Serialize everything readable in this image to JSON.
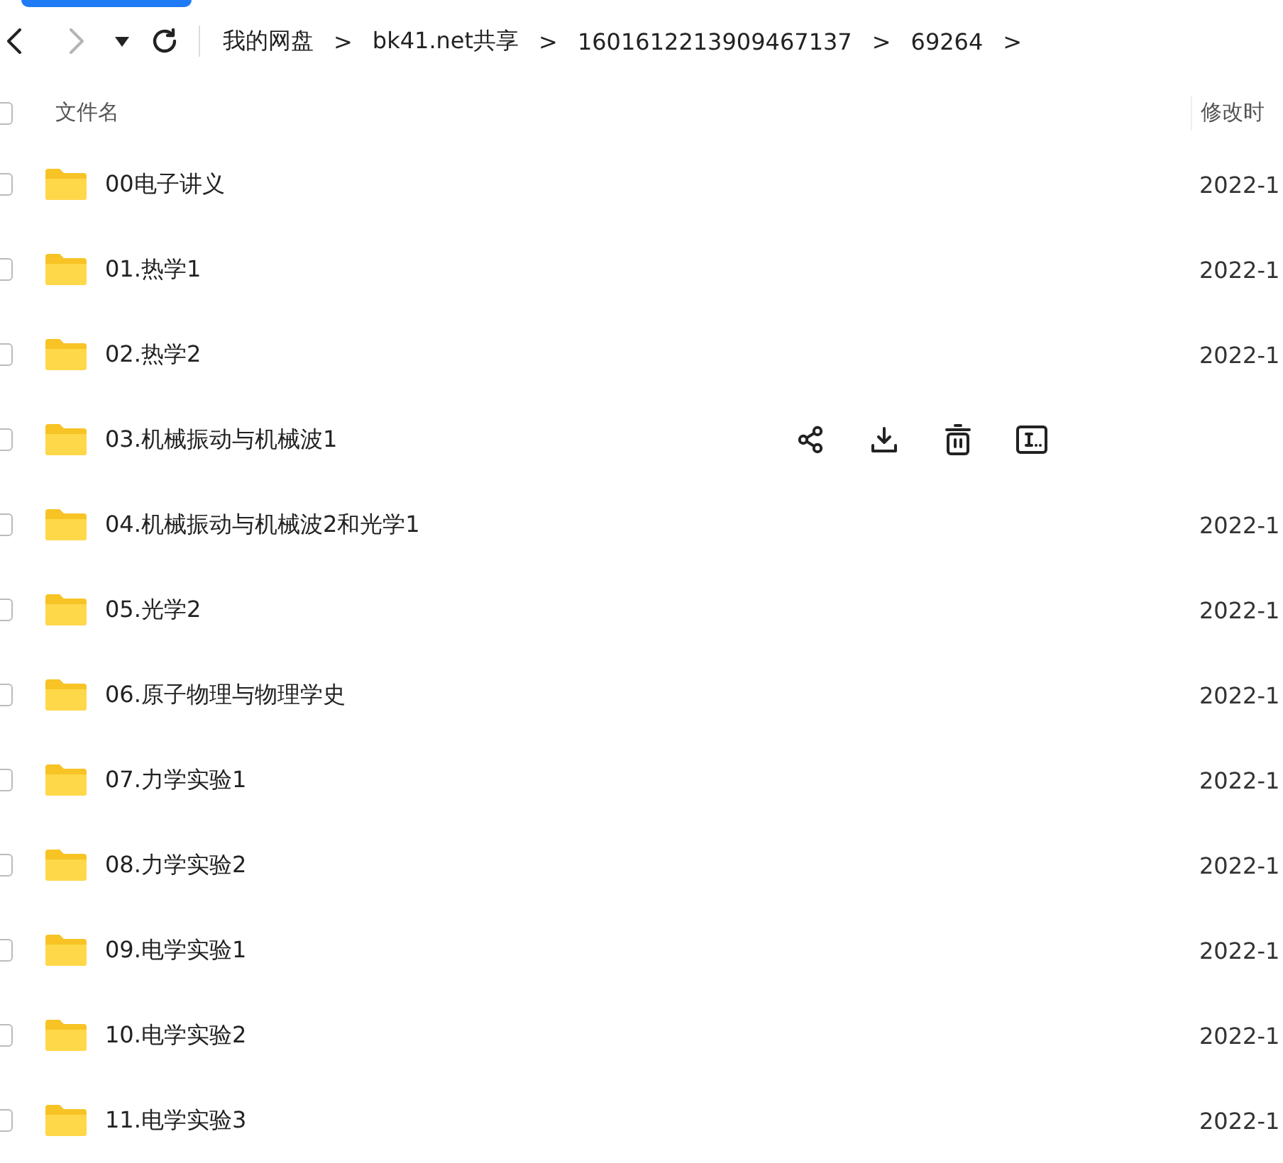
{
  "nav": {
    "back_disabled": false,
    "forward_disabled": true
  },
  "breadcrumb": [
    "我的网盘",
    "bk41.net共享",
    "1601612213909467137",
    "69264"
  ],
  "breadcrumb_separator": ">",
  "columns": {
    "name": "文件名",
    "modified": "修改时",
    "all_checked": false
  },
  "rows": [
    {
      "name": "00电子讲义",
      "modified": "2022-1",
      "hovered": false,
      "checked": false
    },
    {
      "name": "01.热学1",
      "modified": "2022-1",
      "hovered": false,
      "checked": false
    },
    {
      "name": "02.热学2",
      "modified": "2022-1",
      "hovered": false,
      "checked": false
    },
    {
      "name": "03.机械振动与机械波1",
      "hovered": true,
      "checked": false
    },
    {
      "name": "04.机械振动与机械波2和光学1",
      "modified": "2022-1",
      "hovered": false,
      "checked": false
    },
    {
      "name": "05.光学2",
      "modified": "2022-1",
      "hovered": false,
      "checked": false
    },
    {
      "name": "06.原子物理与物理学史",
      "modified": "2022-1",
      "hovered": false,
      "checked": false
    },
    {
      "name": "07.力学实验1",
      "modified": "2022-1",
      "hovered": false,
      "checked": false
    },
    {
      "name": "08.力学实验2",
      "modified": "2022-1",
      "hovered": false,
      "checked": false
    },
    {
      "name": "09.电学实验1",
      "modified": "2022-1",
      "hovered": false,
      "checked": false
    },
    {
      "name": "10.电学实验2",
      "modified": "2022-1",
      "hovered": false,
      "checked": false
    },
    {
      "name": "11.电学实验3",
      "modified": "2022-1",
      "hovered": false,
      "checked": false
    }
  ]
}
